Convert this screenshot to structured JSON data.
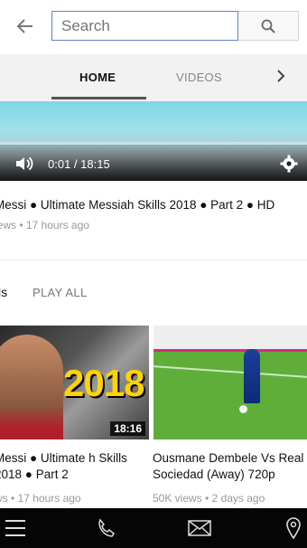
{
  "search": {
    "placeholder": "Search"
  },
  "tabs": [
    {
      "label": "HOME"
    },
    {
      "label": "VIDEOS"
    }
  ],
  "player": {
    "time": "0:01 / 18:15"
  },
  "featured": {
    "title": "Messi ● Ultimate Messiah Skills 2018 ● Part 2 ● HD",
    "meta": "iews • 17 hours ago"
  },
  "section": {
    "title": "ls",
    "play_all": "PLAY ALL"
  },
  "videos": [
    {
      "thumb_text": "2018",
      "duration": "18:16",
      "title": "Messi ● Ultimate h Skills 2018 ● Part 2",
      "meta": "ws • 17 hours ago"
    },
    {
      "title": "Ousmane Dembele Vs Real Sociedad (Away) 720p",
      "meta": "50K views • 2 days ago"
    }
  ],
  "icons": [
    "back-arrow-icon",
    "search-icon",
    "chevron-right-icon",
    "volume-icon",
    "gear-icon",
    "menu-icon",
    "phone-icon",
    "mail-icon",
    "location-pin-icon"
  ],
  "colors": {
    "search_border": "#5b84c9",
    "nav_bg": "#050505",
    "year_yellow": "#ffd400"
  }
}
